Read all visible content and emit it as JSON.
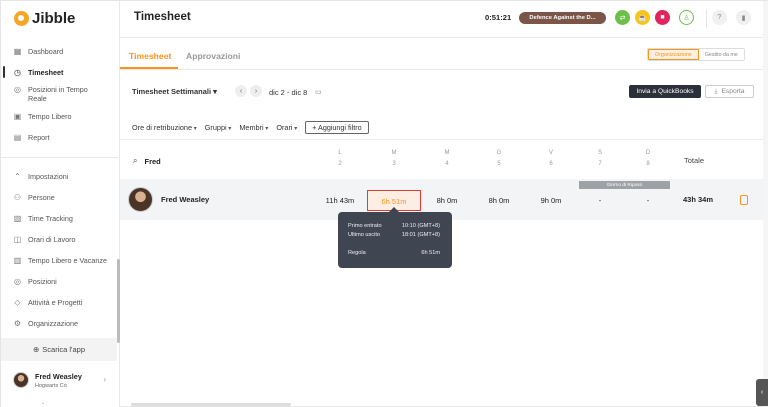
{
  "app": {
    "name": "Jibble",
    "brand_color": "#f7941d"
  },
  "sidebar": {
    "items": [
      {
        "label": "Dashboard",
        "icon": "grid-icon"
      },
      {
        "label": "Timesheet",
        "icon": "clock-icon"
      },
      {
        "label": "Posizioni in Tempo Reale",
        "icon": "location-icon"
      },
      {
        "label": "Tempo Libero",
        "icon": "suitcase-icon"
      },
      {
        "label": "Report",
        "icon": "report-icon"
      }
    ],
    "settings_items": [
      {
        "label": "Impostazioni",
        "icon": "chevron-up-icon"
      },
      {
        "label": "Persone",
        "icon": "people-icon"
      },
      {
        "label": "Time Tracking",
        "icon": "time-tracking-icon"
      },
      {
        "label": "Orari di Lavoro",
        "icon": "work-schedule-icon"
      },
      {
        "label": "Tempo Libero e Vacanze",
        "icon": "vacation-icon"
      },
      {
        "label": "Posizioni",
        "icon": "location-icon"
      },
      {
        "label": "Attività e Progetti",
        "icon": "tag-icon"
      },
      {
        "label": "Organizzazione",
        "icon": "gear-icon"
      }
    ],
    "download_label": "Scarica l'app",
    "user": {
      "name": "Fred Weasley",
      "org": "Hogwarts Co"
    }
  },
  "header": {
    "title": "Timesheet",
    "timer": "0:51:21",
    "activity": "Defence Against the D..."
  },
  "tabs": {
    "items": [
      "Timesheet",
      "Approvazioni"
    ],
    "scope": [
      "Organizzazione",
      "Gestito da me"
    ]
  },
  "toolbar": {
    "view": "Timesheet Settimanali",
    "range": "dic 2 - dic 8",
    "quickbooks": "Invia a QuickBooks",
    "export": "Esporta",
    "filters": [
      "Ore di retribuzione",
      "Gruppi",
      "Membri",
      "Orari"
    ],
    "add_filter": "Aggiungi filtro"
  },
  "grid": {
    "search_value": "Fred",
    "days": [
      {
        "d": "L",
        "n": "2"
      },
      {
        "d": "M",
        "n": "3"
      },
      {
        "d": "M",
        "n": "4"
      },
      {
        "d": "G",
        "n": "5"
      },
      {
        "d": "V",
        "n": "6"
      },
      {
        "d": "S",
        "n": "7"
      },
      {
        "d": "D",
        "n": "8"
      }
    ],
    "total_label": "Totale",
    "row": {
      "name": "Fred Weasley",
      "values": [
        "11h 43m",
        "6h 51m",
        "8h 0m",
        "8h 0m",
        "9h 0m",
        "-",
        "-"
      ],
      "total": "43h 34m",
      "holiday": "Giorno di Riposo"
    }
  },
  "tooltip": {
    "first_in_label": "Primo entrato",
    "first_in_value": "10:10 (GMT+8)",
    "last_out_label": "Ultimo uscito",
    "last_out_value": "18:01 (GMT+8)",
    "regular_label": "Regola",
    "regular_value": "6h 51m"
  }
}
